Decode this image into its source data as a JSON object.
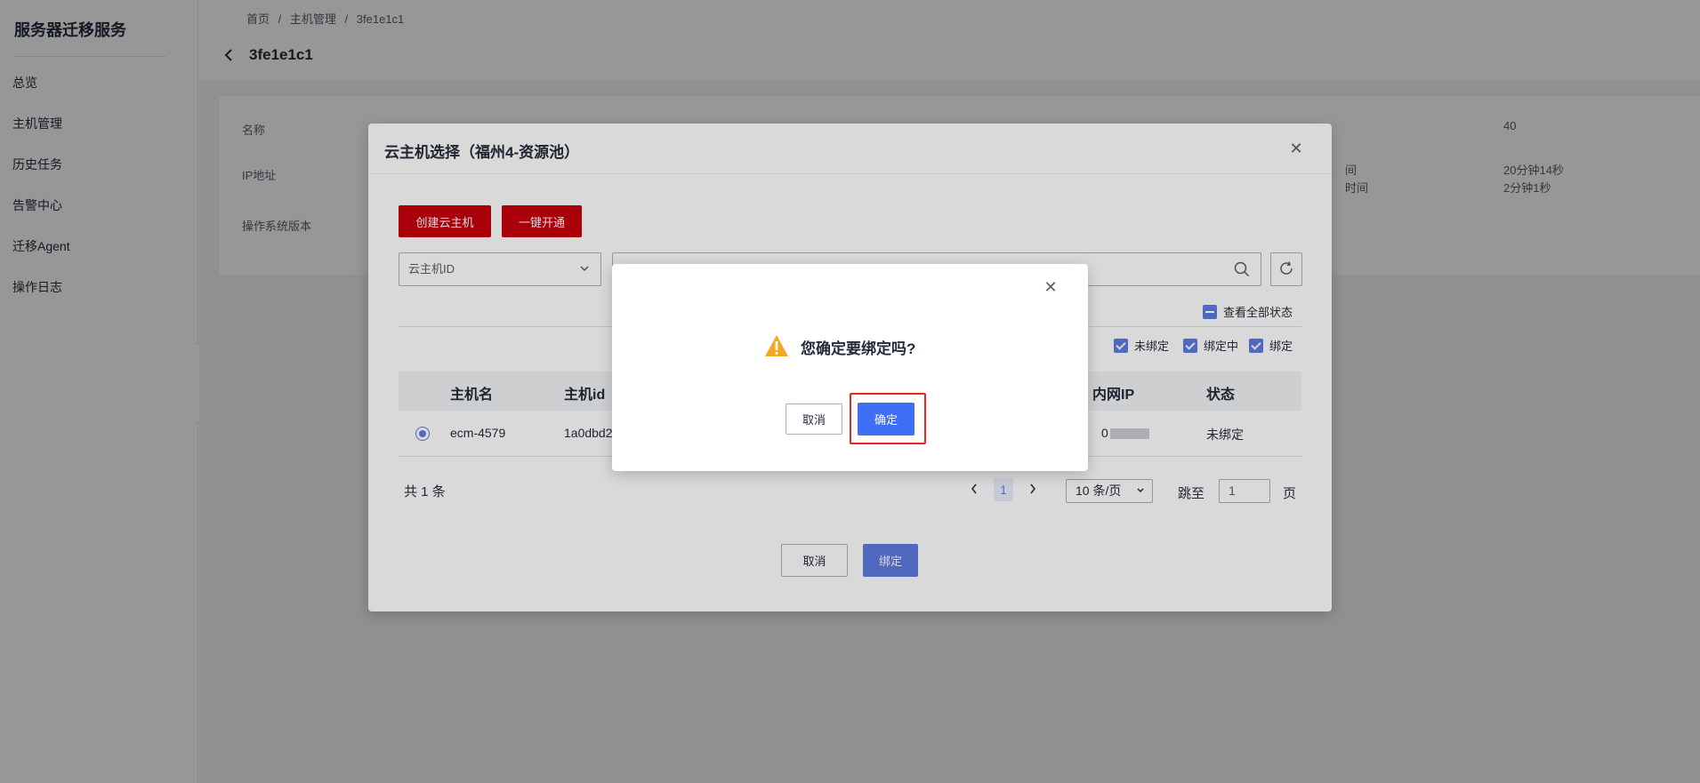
{
  "sidebar": {
    "title": "服务器迁移服务",
    "items": [
      {
        "label": "总览"
      },
      {
        "label": "主机管理"
      },
      {
        "label": "历史任务"
      },
      {
        "label": "告警中心"
      },
      {
        "label": "迁移Agent"
      },
      {
        "label": "操作日志"
      }
    ]
  },
  "breadcrumb": {
    "home": "首页",
    "sep1": "/",
    "host_mgmt": "主机管理",
    "sep2": "/",
    "current": "3fe1e1c1"
  },
  "page": {
    "title": "3fe1e1c1"
  },
  "info": {
    "name_label": "名称",
    "ip_label": "IP地址",
    "os_label": "操作系统版本",
    "col3_line1": "间",
    "col3_line2": "时间",
    "col4_value": "40",
    "col4_line1": "20分钟14秒",
    "col4_line2": "2分钟1秒"
  },
  "select_dialog": {
    "title": "云主机选择（福州4-资源池）",
    "create_button": "创建云主机",
    "quick_button": "一键开通",
    "filter_select": "云主机ID",
    "search_placeholder": "",
    "view_all_status": "查看全部状态",
    "status_filters": [
      "未绑定",
      "绑定中",
      "绑定"
    ],
    "columns": {
      "host_name": "主机名",
      "host_id": "主机id",
      "ip": "内网IP",
      "status": "状态"
    },
    "rows": [
      {
        "host_name": "ecm-4579",
        "host_id": "1a0dbd2",
        "ip": "0",
        "status": "未绑定"
      }
    ],
    "total": "共 1 条",
    "current_page": "1",
    "page_size": "10 条/页",
    "jump_label": "跳至",
    "jump_value": "1",
    "page_unit": "页",
    "cancel": "取消",
    "bind": "绑定"
  },
  "confirm": {
    "message": "您确定要绑定吗?",
    "cancel": "取消",
    "ok": "确定"
  },
  "colors": {
    "brand_red": "#c7000b",
    "primary": "#5e7ce0",
    "highlight_red": "#e5271d",
    "warning": "#f5a623"
  }
}
